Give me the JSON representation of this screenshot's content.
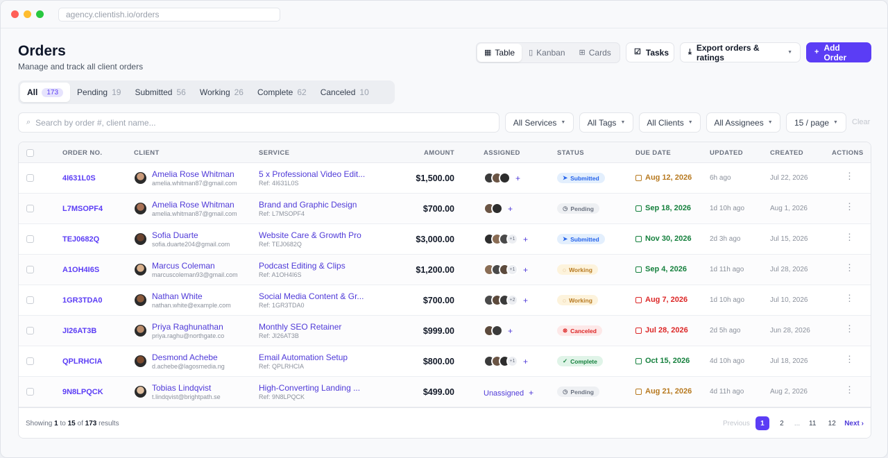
{
  "browser": {
    "url": "agency.clientish.io/orders"
  },
  "header": {
    "title": "Orders",
    "subtitle": "Manage and track all client orders",
    "views": [
      {
        "label": "Table",
        "icon": "table-icon",
        "active": true
      },
      {
        "label": "Kanban",
        "icon": "kanban-icon",
        "active": false
      },
      {
        "label": "Cards",
        "icon": "cards-icon",
        "active": false
      }
    ],
    "tasks_label": "Tasks",
    "export_label": "Export orders & ratings",
    "add_label": "Add Order"
  },
  "status_tabs": [
    {
      "label": "All",
      "count": "173",
      "active": true
    },
    {
      "label": "Pending",
      "count": "19"
    },
    {
      "label": "Submitted",
      "count": "56"
    },
    {
      "label": "Working",
      "count": "26"
    },
    {
      "label": "Complete",
      "count": "62"
    },
    {
      "label": "Canceled",
      "count": "10"
    }
  ],
  "filters": {
    "search_placeholder": "Search by order #, client name...",
    "services": "All Services",
    "tags": "All Tags",
    "clients": "All Clients",
    "assignees": "All Assignees",
    "per_page": "15 / page",
    "clear": "Clear"
  },
  "table": {
    "columns": [
      "ORDER NO.",
      "CLIENT",
      "SERVICE",
      "AMOUNT",
      "ASSIGNED",
      "STATUS",
      "DUE DATE",
      "UPDATED",
      "CREATED",
      "ACTIONS"
    ],
    "rows": [
      {
        "order": "4I631L0S",
        "client": "Amelia Rose Whitman",
        "email": "amelia.whitman87@gmail.com",
        "service": "5 x Professional Video Edit...",
        "ref": "Ref: 4I631L0S",
        "amount": "$1,500.00",
        "assignees": 3,
        "more": "",
        "status": "Submitted",
        "status_class": "submitted",
        "status_icon": "send-icon",
        "due": "Aug 12, 2026",
        "due_class": "amber",
        "updated": "6h ago",
        "created": "Jul 22, 2026"
      },
      {
        "order": "L7MSOPF4",
        "client": "Amelia Rose Whitman",
        "email": "amelia.whitman87@gmail.com",
        "service": "Brand and Graphic Design",
        "ref": "Ref: L7MSOPF4",
        "amount": "$700.00",
        "assignees": 2,
        "more": "",
        "status": "Pending",
        "status_class": "pending",
        "status_icon": "clock-icon",
        "due": "Sep 18, 2026",
        "due_class": "green",
        "updated": "1d 10h ago",
        "created": "Aug 1, 2026"
      },
      {
        "order": "TEJ0682Q",
        "client": "Sofia Duarte",
        "email": "sofia.duarte204@gmail.com",
        "service": "Website Care & Growth Pro",
        "ref": "Ref: TEJ0682Q",
        "amount": "$3,000.00",
        "assignees": 3,
        "more": "+1",
        "status": "Submitted",
        "status_class": "submitted",
        "status_icon": "send-icon",
        "due": "Nov 30, 2026",
        "due_class": "green",
        "updated": "2d 3h ago",
        "created": "Jul 15, 2026"
      },
      {
        "order": "A1OH4I6S",
        "client": "Marcus Coleman",
        "email": "marcuscoleman93@gmail.com",
        "service": "Podcast Editing & Clips",
        "ref": "Ref: A1OH4I6S",
        "amount": "$1,200.00",
        "assignees": 3,
        "more": "+1",
        "status": "Working",
        "status_class": "working",
        "status_icon": "spinner-icon",
        "due": "Sep 4, 2026",
        "due_class": "green",
        "updated": "1d 11h ago",
        "created": "Jul 28, 2026"
      },
      {
        "order": "1GR3TDA0",
        "client": "Nathan White",
        "email": "nathan.white@example.com",
        "service": "Social Media Content & Gr...",
        "ref": "Ref: 1GR3TDA0",
        "amount": "$700.00",
        "assignees": 3,
        "more": "+2",
        "status": "Working",
        "status_class": "working",
        "status_icon": "spinner-icon",
        "due": "Aug 7, 2026",
        "due_class": "red",
        "updated": "1d 10h ago",
        "created": "Jul 10, 2026"
      },
      {
        "order": "JI26AT3B",
        "client": "Priya Raghunathan",
        "email": "priya.raghu@northgate.co",
        "service": "Monthly SEO Retainer",
        "ref": "Ref: JI26AT3B",
        "amount": "$999.00",
        "assignees": 2,
        "more": "",
        "status": "Canceled",
        "status_class": "canceled",
        "status_icon": "x-circle-icon",
        "due": "Jul 28, 2026",
        "due_class": "red",
        "updated": "2d 5h ago",
        "created": "Jun 28, 2026"
      },
      {
        "order": "QPLRHCIA",
        "client": "Desmond Achebe",
        "email": "d.achebe@lagosmedia.ng",
        "service": "Email Automation Setup",
        "ref": "Ref: QPLRHCIA",
        "amount": "$800.00",
        "assignees": 3,
        "more": "+1",
        "status": "Complete",
        "status_class": "complete",
        "status_icon": "check-circle-icon",
        "due": "Oct 15, 2026",
        "due_class": "green",
        "updated": "4d 10h ago",
        "created": "Jul 18, 2026"
      },
      {
        "order": "9N8LPQCK",
        "client": "Tobias Lindqvist",
        "email": "t.lindqvist@brightpath.se",
        "service": "High-Converting Landing ...",
        "ref": "Ref: 9N8LPQCK",
        "amount": "$499.00",
        "assignees": 0,
        "unassigned": "Unassigned",
        "more": "",
        "status": "Pending",
        "status_class": "pending",
        "status_icon": "clock-icon",
        "due": "Aug 21, 2026",
        "due_class": "amber",
        "updated": "4d 11h ago",
        "created": "Aug 2, 2026"
      }
    ]
  },
  "footer": {
    "showing_prefix": "Showing",
    "from": "1",
    "to_word": "to",
    "to": "15",
    "of_word": "of",
    "total": "173",
    "results_word": "results",
    "previous": "Previous",
    "pages": [
      "1",
      "2",
      "...",
      "11",
      "12"
    ],
    "current_page": "1",
    "next": "Next ›"
  },
  "colors": {
    "accent": "#5b3df5",
    "link": "#4f3ad8"
  }
}
